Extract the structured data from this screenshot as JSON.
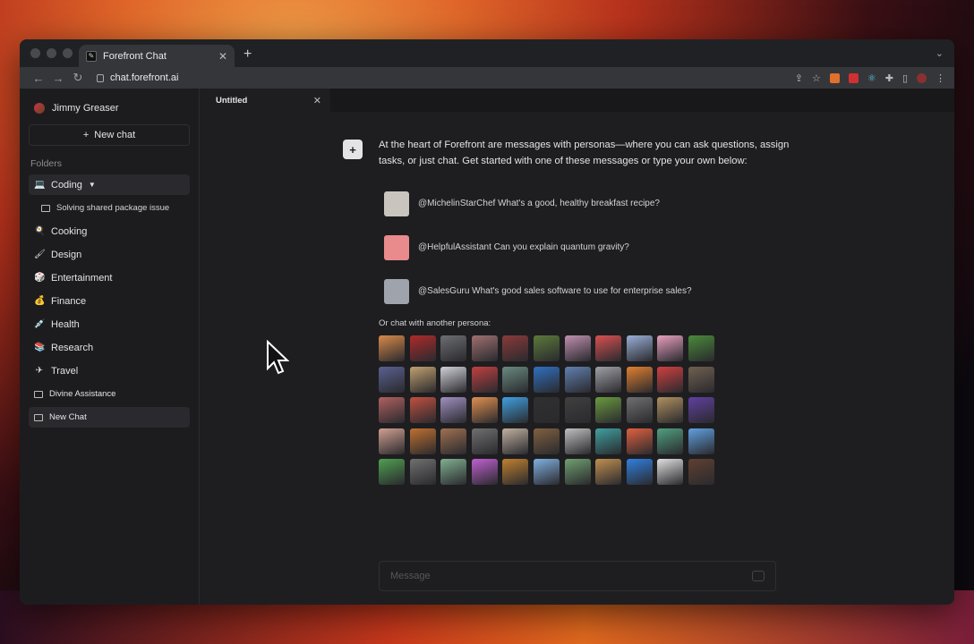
{
  "browser": {
    "tab_title": "Forefront Chat",
    "url": "chat.forefront.ai"
  },
  "sidebar": {
    "user_name": "Jimmy Greaser",
    "new_chat_label": "New chat",
    "folders_label": "Folders",
    "items": [
      {
        "label": "Coding",
        "icon": "laptop-icon"
      },
      {
        "label": "Solving shared package issue",
        "icon": "chat-bubble-icon"
      },
      {
        "label": "Cooking",
        "icon": "frying-pan-icon"
      },
      {
        "label": "Design",
        "icon": "paintbrush-icon"
      },
      {
        "label": "Entertainment",
        "icon": "die-icon"
      },
      {
        "label": "Finance",
        "icon": "money-bag-icon"
      },
      {
        "label": "Health",
        "icon": "syringe-icon"
      },
      {
        "label": "Research",
        "icon": "books-icon"
      },
      {
        "label": "Travel",
        "icon": "airplane-icon"
      },
      {
        "label": "Divine Assistance",
        "icon": "chat-bubble-icon"
      },
      {
        "label": "New Chat",
        "icon": "chat-bubble-icon"
      }
    ]
  },
  "doc_tab": {
    "label": "Untitled"
  },
  "intro_text": "At the heart of Forefront are messages with personas—where you can ask questions, assign tasks, or just chat. Get started with one of these messages or type your own below:",
  "suggestions": [
    {
      "text": "@MichelinStarChef What's a good, healthy breakfast recipe?",
      "color": "#c9c4bd"
    },
    {
      "text": "@HelpfulAssistant Can you explain quantum gravity?",
      "color": "#e98a8c"
    },
    {
      "text": "@SalesGuru What's good sales software to use for enterprise sales?",
      "color": "#9fa3ab"
    }
  ],
  "or_label": "Or chat with another persona:",
  "persona_colors": [
    "#d88a4a",
    "#b02a2a",
    "#6d6e71",
    "#a07070",
    "#8a3a3a",
    "#5c7a3a",
    "#c090b0",
    "#d85050",
    "#9ab0d8",
    "#e8a0c0",
    "#4a8a3a",
    "#5a6090",
    "#c0a070",
    "#d0d0d8",
    "#c04040",
    "#6a8a80",
    "#3070c0",
    "#6080b0",
    "#a0a0a8",
    "#e08030",
    "#d04040",
    "#706050",
    "#b06060",
    "#c05040",
    "#a090c0",
    "#e09050",
    "#40a0e0",
    "#303030",
    "#404040",
    "#6a9a40",
    "#707070",
    "#b09060",
    "#6040a0",
    "#d0a090",
    "#c07030",
    "#a07050",
    "#707070",
    "#c0b0a0",
    "#806040",
    "#c0c0c0",
    "#40a0a0",
    "#e06040",
    "#50a080",
    "#60a0e0",
    "#50a050",
    "#707070",
    "#80b090",
    "#c060d0",
    "#c08030",
    "#80b0e0",
    "#70a070",
    "#c09050",
    "#3080e0",
    "#e0e0e0",
    "#604030"
  ],
  "message": {
    "placeholder": "Message"
  }
}
